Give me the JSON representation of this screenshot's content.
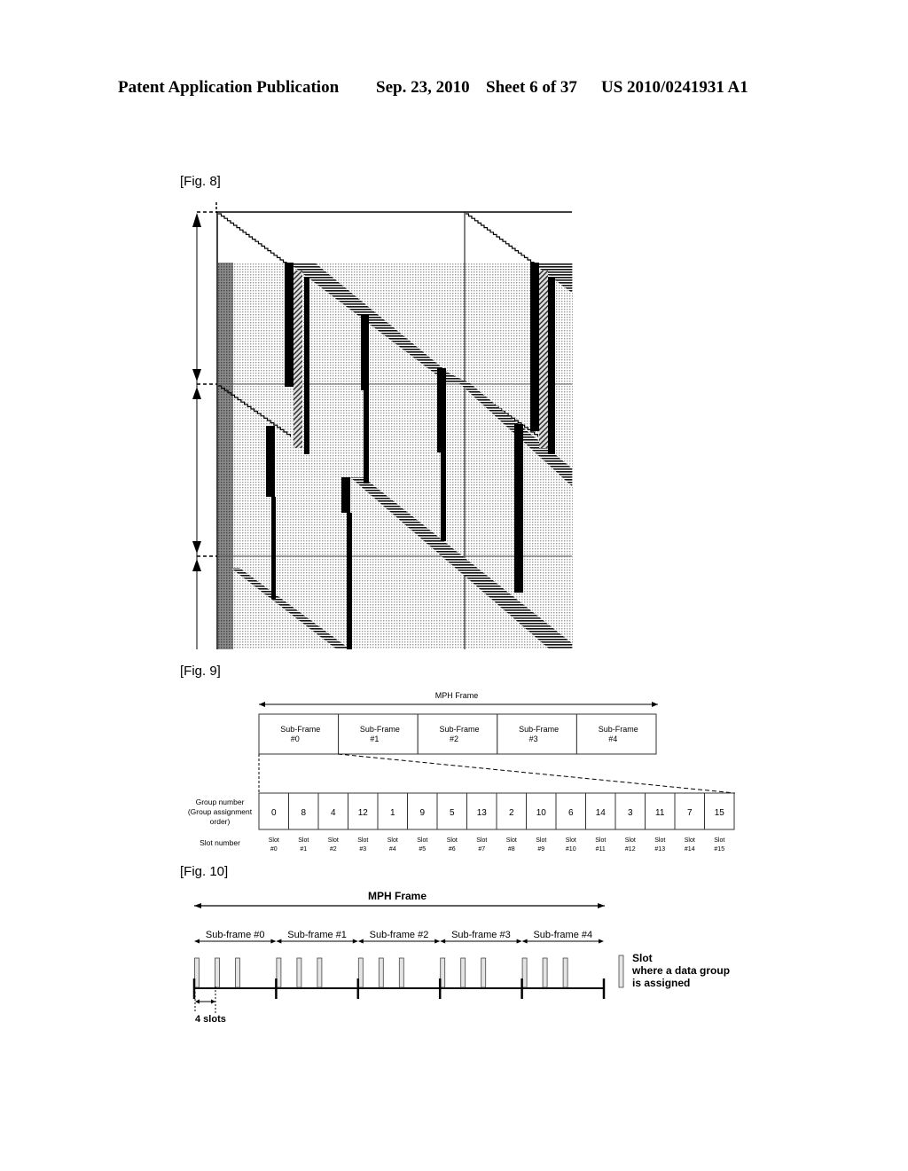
{
  "header": {
    "publication": "Patent Application Publication",
    "date": "Sep. 23, 2010",
    "sheet": "Sheet 6 of 37",
    "number": "US 2010/0241931 A1"
  },
  "fig8": {
    "label": "[Fig. 8]"
  },
  "fig9": {
    "label": "[Fig. 9]",
    "frame_label": "MPH Frame",
    "subframes": [
      {
        "line1": "Sub-Frame",
        "line2": "#0"
      },
      {
        "line1": "Sub-Frame",
        "line2": "#1"
      },
      {
        "line1": "Sub-Frame",
        "line2": "#2"
      },
      {
        "line1": "Sub-Frame",
        "line2": "#3"
      },
      {
        "line1": "Sub-Frame",
        "line2": "#4"
      }
    ],
    "group_row_label": [
      "Group number",
      "(Group assignment",
      "order)"
    ],
    "slot_row_label": "Slot number",
    "group_numbers": [
      "0",
      "8",
      "4",
      "12",
      "1",
      "9",
      "5",
      "13",
      "2",
      "10",
      "6",
      "14",
      "3",
      "11",
      "7",
      "15"
    ],
    "slot_prefix": "Slot",
    "slots": [
      "#0",
      "#1",
      "#2",
      "#3",
      "#4",
      "#5",
      "#6",
      "#7",
      "#8",
      "#9",
      "#10",
      "#11",
      "#12",
      "#13",
      "#14",
      "#15"
    ]
  },
  "fig10": {
    "label": "[Fig. 10]",
    "frame_label": "MPH Frame",
    "subframes": [
      "Sub-frame #0",
      "Sub-frame #1",
      "Sub-frame #2",
      "Sub-frame #3",
      "Sub-frame #4"
    ],
    "span_label": "4 slots",
    "legend": [
      "Slot",
      "where a data group",
      "is assigned"
    ],
    "assigned_slots_per_subframe": 3
  }
}
